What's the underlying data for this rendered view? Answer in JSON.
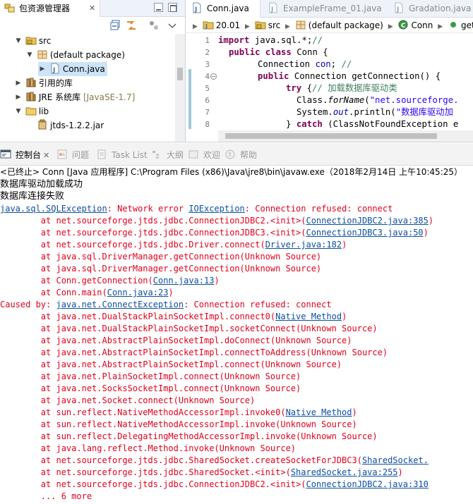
{
  "package_explorer": {
    "tab_label": "包资源管理器",
    "tree": [
      {
        "label": "src",
        "expanded": true,
        "icon": "source-folder-icon"
      },
      {
        "label": "(default package)",
        "expanded": true,
        "icon": "package-icon"
      },
      {
        "label": "Conn.java",
        "expanded": false,
        "selected": true,
        "icon": "java-file-icon"
      },
      {
        "label": "引用的库",
        "expanded": false,
        "icon": "library-icon"
      },
      {
        "label": "JRE 系统库",
        "suffix": "[JavaSE-1.7]",
        "expanded": false,
        "icon": "jre-library-icon"
      },
      {
        "label": "lib",
        "expanded": true,
        "icon": "folder-icon"
      },
      {
        "label": "jtds-1.2.2.jar",
        "icon": "jar-icon"
      }
    ]
  },
  "editor": {
    "tabs": [
      {
        "label": "Conn.java",
        "active": true
      },
      {
        "label": "ExampleFrame_01.java",
        "active": false
      },
      {
        "label": "Gradation.java",
        "active": false
      }
    ],
    "breadcrumb": [
      "20.01",
      "src",
      "(default package)",
      "Conn",
      "get"
    ],
    "line_numbers": [
      "1",
      "2",
      "3",
      "4",
      "5",
      "6",
      "7",
      "8"
    ],
    "code": {
      "l1_kw": "import",
      "l1_rest": " java.sql.*;",
      "l1_cm": "//",
      "l2_kw": "public class",
      "l2_rest": " Conn {",
      "l3_a": "Connection ",
      "l3_fld": "con",
      "l3_b": "; ",
      "l3_cm": "//",
      "l4_kw": "public",
      "l4_rest": " Connection getConnection() {",
      "l5_kw": "try",
      "l5_rest": " {",
      "l5_cm": "// 加载数据库驱动类",
      "l6_a": "Class.",
      "l6_m": "forName",
      "l6_b": "(",
      "l6_st": "\"net.sourceforge.",
      "l7_a": "System.",
      "l7_fld": "out",
      "l7_b": ".println(",
      "l7_st": "\"数据库驱动加",
      "l8_a": "} ",
      "l8_kw": "catch",
      "l8_rest": " (ClassNotFoundException e"
    }
  },
  "console": {
    "tabs": [
      {
        "label": "控制台",
        "active": true
      },
      {
        "label": "问题",
        "active": false
      },
      {
        "label": "Task List",
        "active": false
      },
      {
        "label": "大纲",
        "active": false
      },
      {
        "label": "欢迎",
        "active": false
      },
      {
        "label": "帮助",
        "active": false
      }
    ],
    "header": "<已终止> Conn [Java 应用程序] C:\\Program Files (x86)\\Java\\jre8\\bin\\javaw.exe（2018年2月14日 上午10:45:25）",
    "output": [
      "数据库驱动加载成功",
      "数据库连接失败"
    ],
    "stack": {
      "e1_link": "java.sql.SQLException",
      "e1_mid": ": Network error ",
      "e1_link2": "IOException",
      "e1_end": ": Connection refused: connect",
      "s1_a": "        at net.sourceforge.jtds.jdbc.ConnectionJDBC2.<init>(",
      "s1_link": "ConnectionJDBC2.java:385",
      "s1_b": ")",
      "s2_a": "        at net.sourceforge.jtds.jdbc.ConnectionJDBC3.<init>(",
      "s2_link": "ConnectionJDBC3.java:50",
      "s2_b": ")",
      "s3_a": "        at net.sourceforge.jtds.jdbc.Driver.connect(",
      "s3_link": "Driver.java:182",
      "s3_b": ")",
      "s4": "        at java.sql.DriverManager.getConnection(Unknown Source)",
      "s5": "        at java.sql.DriverManager.getConnection(Unknown Source)",
      "s6_a": "        at Conn.getConnection(",
      "s6_link": "Conn.java:13",
      "s6_b": ")",
      "s7_a": "        at Conn.main(",
      "s7_link": "Conn.java:23",
      "s7_b": ")",
      "c_a": "Caused by: ",
      "c_link": "java.net.ConnectException",
      "c_b": ": Connection refused: connect",
      "t1_a": "        at java.net.DualStackPlainSocketImpl.connect0(",
      "t1_link": "Native Method",
      "t1_b": ")",
      "t2": "        at java.net.DualStackPlainSocketImpl.socketConnect(Unknown Source)",
      "t3": "        at java.net.AbstractPlainSocketImpl.doConnect(Unknown Source)",
      "t4": "        at java.net.AbstractPlainSocketImpl.connectToAddress(Unknown Source)",
      "t5": "        at java.net.AbstractPlainSocketImpl.connect(Unknown Source)",
      "t6": "        at java.net.PlainSocketImpl.connect(Unknown Source)",
      "t7": "        at java.net.SocksSocketImpl.connect(Unknown Source)",
      "t8": "        at java.net.Socket.connect(Unknown Source)",
      "t9_a": "        at sun.reflect.NativeMethodAccessorImpl.invoke0(",
      "t9_link": "Native Method",
      "t9_b": ")",
      "t10": "        at sun.reflect.NativeMethodAccessorImpl.invoke(Unknown Source)",
      "t11": "        at sun.reflect.DelegatingMethodAccessorImpl.invoke(Unknown Source)",
      "t12": "        at java.lang.reflect.Method.invoke(Unknown Source)",
      "t13_a": "        at net.sourceforge.jtds.jdbc.SharedSocket.createSocketForJDBC3(",
      "t13_link": "SharedSocket.",
      "t14_a": "        at net.sourceforge.jtds.jdbc.SharedSocket.<init>(",
      "t14_link": "SharedSocket.java:255",
      "t14_b": ")",
      "t15_a": "        at net.sourceforge.jtds.jdbc.ConnectionJDBC2.<init>(",
      "t15_link": "ConnectionJDBC2.java:310",
      "t16": "        ... 6 more"
    }
  },
  "colors": {
    "error_text": "#e0001c",
    "link": "#0b4ea5",
    "keyword": "#7f0055",
    "comment": "#3f7f5f",
    "string": "#2a00ff",
    "field": "#0000c0",
    "selection": "#cce4f7"
  }
}
